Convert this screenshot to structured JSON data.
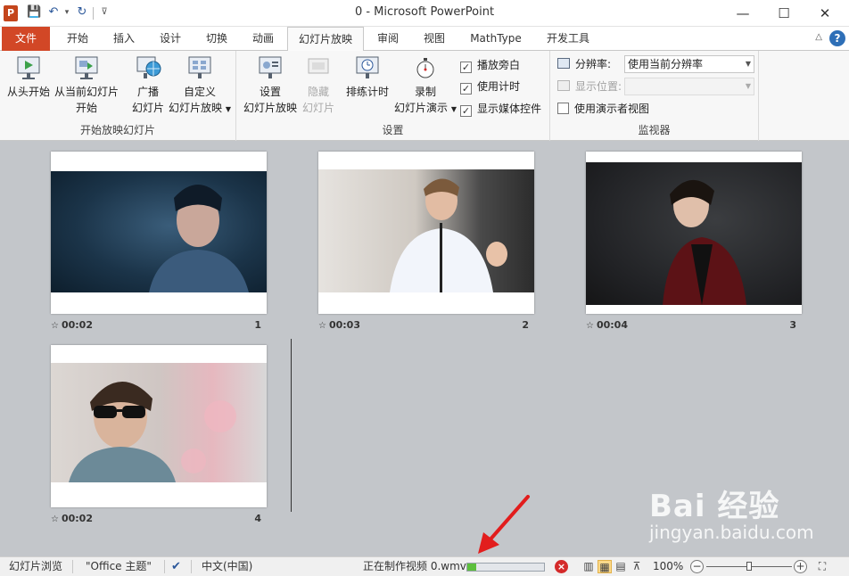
{
  "window": {
    "title": "0  -  Microsoft PowerPoint",
    "app_logo": "P",
    "controls": {
      "minimize": "—",
      "maximize": "☐",
      "close": "✕"
    },
    "qat": {
      "save": "💾",
      "undo": "↶",
      "undo_dd": "▾",
      "redo": "↻",
      "customize": "⊽"
    }
  },
  "tabs": {
    "file": "文件",
    "items": [
      "开始",
      "插入",
      "设计",
      "切换",
      "动画",
      "幻灯片放映",
      "审阅",
      "视图",
      "MathType",
      "开发工具"
    ],
    "active": "幻灯片放映",
    "help": "?",
    "collapse": "△"
  },
  "ribbon": {
    "group_start": {
      "label": "开始放映幻灯片",
      "from_beginning": "从头开始",
      "from_current_1": "从当前幻灯片",
      "from_current_2": "开始",
      "broadcast_1": "广播",
      "broadcast_2": "幻灯片",
      "custom_1": "自定义",
      "custom_2": "幻灯片放映"
    },
    "group_setup": {
      "label": "设置",
      "setup_1": "设置",
      "setup_2": "幻灯片放映",
      "hide_1": "隐藏",
      "hide_2": "幻灯片",
      "rehearse": "排练计时",
      "record_1": "录制",
      "record_2": "幻灯片演示",
      "check_narration": "播放旁白",
      "check_timings": "使用计时",
      "check_media": "显示媒体控件"
    },
    "group_monitor": {
      "label": "监视器",
      "resolution_label": "分辨率:",
      "resolution_value": "使用当前分辨率",
      "show_on_label": "显示位置:",
      "show_on_value": "",
      "presenter_view": "使用演示者视图"
    }
  },
  "slides": [
    {
      "time": "00:02",
      "num": "1"
    },
    {
      "time": "00:03",
      "num": "2"
    },
    {
      "time": "00:04",
      "num": "3"
    },
    {
      "time": "00:02",
      "num": "4"
    }
  ],
  "statusbar": {
    "view_name": "幻灯片浏览",
    "theme": "\"Office 主题\"",
    "language": "中文(中国)",
    "task": "正在制作视频 0.wmv",
    "progress": 0.12,
    "zoom": "100%",
    "zoom_minus": "−",
    "zoom_plus": "+"
  },
  "watermark": {
    "top": "Bai 经验",
    "bottom": "jingyan.baidu.com"
  },
  "colors": {
    "file_tab": "#d24726",
    "accent": "#2b579a",
    "progress": "#5cbf3c"
  }
}
